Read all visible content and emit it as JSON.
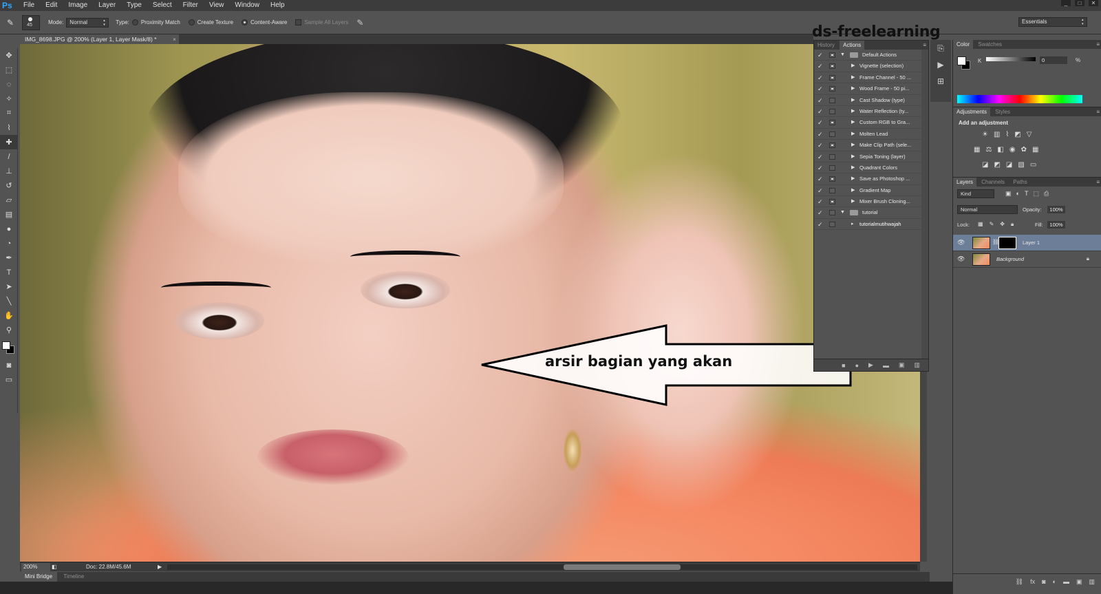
{
  "app": {
    "logo": "Ps"
  },
  "menu": [
    "File",
    "Edit",
    "Image",
    "Layer",
    "Type",
    "Select",
    "Filter",
    "View",
    "Window",
    "Help"
  ],
  "window_controls": [
    "_",
    "□",
    "✕"
  ],
  "options": {
    "brush_size": "45",
    "mode_label": "Mode:",
    "mode_value": "Normal",
    "type_label": "Type:",
    "proximity": "Proximity Match",
    "create_texture": "Create Texture",
    "content_aware": "Content-Aware",
    "sample_all": "Sample All Layers",
    "workspace": "Essentials"
  },
  "tools": [
    "move-tool",
    "marquee-tool",
    "lasso-tool",
    "quick-select-tool",
    "crop-tool",
    "eyedropper-tool",
    "spot-healing-tool",
    "brush-tool",
    "clone-stamp-tool",
    "history-brush-tool",
    "eraser-tool",
    "gradient-tool",
    "blur-tool",
    "dodge-tool",
    "pen-tool",
    "type-tool",
    "path-select-tool",
    "line-tool",
    "hand-tool",
    "zoom-tool"
  ],
  "document": {
    "tab": "IMG_8698.JPG @ 200% (Layer 1, Layer Mask/8) *",
    "close": "×"
  },
  "annotation": {
    "text": "arsir bagian yang akan",
    "watermark": "ds-freelearning"
  },
  "status": {
    "zoom": "200%",
    "doc": "Doc: 22.8M/45.6M"
  },
  "bottom_tabs": [
    "Mini Bridge",
    "Timeline"
  ],
  "actions_panel": {
    "tabs": [
      "History",
      "Actions"
    ],
    "items": [
      {
        "label": "Default Actions",
        "type": "folder",
        "dialog": true
      },
      {
        "label": "Vignette (selection)",
        "type": "action",
        "dialog": true
      },
      {
        "label": "Frame Channel - 50 ...",
        "type": "action",
        "dialog": true
      },
      {
        "label": "Wood Frame - 50 pi...",
        "type": "action",
        "dialog": true
      },
      {
        "label": "Cast Shadow (type)",
        "type": "action",
        "dialog": false
      },
      {
        "label": "Water Reflection (ty...",
        "type": "action",
        "dialog": false
      },
      {
        "label": "Custom RGB to Gra...",
        "type": "action",
        "dialog": true
      },
      {
        "label": "Molten Lead",
        "type": "action",
        "dialog": false
      },
      {
        "label": "Make Clip Path (sele...",
        "type": "action",
        "dialog": true
      },
      {
        "label": "Sepia Toning (layer)",
        "type": "action",
        "dialog": false
      },
      {
        "label": "Quadrant Colors",
        "type": "action",
        "dialog": false
      },
      {
        "label": "Save as Photoshop ...",
        "type": "action",
        "dialog": true
      },
      {
        "label": "Gradient Map",
        "type": "action",
        "dialog": false
      },
      {
        "label": "Mixer Brush Cloning...",
        "type": "action",
        "dialog": true
      },
      {
        "label": "tutorial",
        "type": "folder",
        "dialog": false
      },
      {
        "label": "tutorialmutihwajah",
        "type": "action-selected",
        "dialog": false
      }
    ]
  },
  "color_panel": {
    "tabs": [
      "Color",
      "Swatches"
    ],
    "k_label": "K",
    "k_value": "0",
    "pct": "%"
  },
  "adjustments_panel": {
    "tabs": [
      "Adjustments",
      "Styles"
    ],
    "title": "Add an adjustment"
  },
  "layers_panel": {
    "tabs": [
      "Layers",
      "Channels",
      "Paths"
    ],
    "kind": "Kind",
    "blend": "Normal",
    "opacity_label": "Opacity:",
    "opacity": "100%",
    "lock_label": "Lock:",
    "fill_label": "Fill:",
    "fill": "100%",
    "layers": [
      {
        "name": "Layer 1",
        "active": true
      },
      {
        "name": "Background",
        "active": false
      }
    ]
  }
}
